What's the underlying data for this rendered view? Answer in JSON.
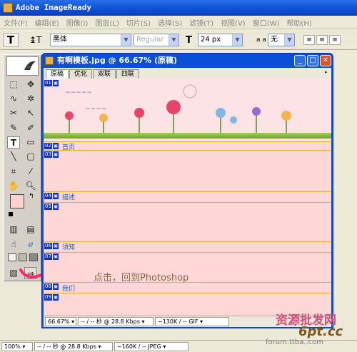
{
  "app": {
    "title": "Adobe ImageReady"
  },
  "menu": [
    "文件(F)",
    "编辑(E)",
    "图像(I)",
    "图层(L)",
    "切片(S)",
    "选择(S)",
    "滤镜(T)",
    "视图(V)",
    "窗口(W)",
    "帮助(H)"
  ],
  "options": {
    "font_family": "黑体",
    "font_style": "Regular",
    "font_size": "24 px",
    "antialias": "无",
    "aa_label": "a a"
  },
  "document": {
    "title": "有啊模板.jpg @ 66.67% (原稿)",
    "tabs": [
      {
        "label": "原稿",
        "active": true
      },
      {
        "label": "优化",
        "active": false
      },
      {
        "label": "双联",
        "active": false
      },
      {
        "label": "四联",
        "active": false
      }
    ],
    "slices": [
      {
        "num": "01",
        "icon": "▣",
        "label": ""
      },
      {
        "num": "02",
        "icon": "▣",
        "label": "首页"
      },
      {
        "num": "03",
        "icon": "▣",
        "label": ""
      },
      {
        "num": "04",
        "icon": "▣",
        "label": "描述"
      },
      {
        "num": "05",
        "icon": "▣",
        "label": ""
      },
      {
        "num": "06",
        "icon": "▣",
        "label": "须知"
      },
      {
        "num": "07",
        "icon": "▣",
        "label": ""
      },
      {
        "num": "08",
        "icon": "▣",
        "label": "我们"
      },
      {
        "num": "09",
        "icon": "▣",
        "label": ""
      }
    ],
    "status": {
      "zoom": "66.67%",
      "speed": "-- / -- 秒 @ 28.8 Kbps",
      "size": "~130K / -- GIF"
    }
  },
  "status": {
    "zoom": "100%",
    "speed": "-- / -- 秒 @ 28.8 Kbps",
    "size": "~160K / -- JPEG"
  },
  "annotation": "点击，回到Photoshop",
  "watermark": {
    "line1": "资源批发网",
    "line2": "6pt.cc",
    "line3": "forum.ttba..com"
  },
  "colors": {
    "accent": "#0a4fd6",
    "canvas": "#ffd7d7",
    "slice_badge": "#1030c8",
    "slice_line": "#e6b22e"
  },
  "toolbox_icons": [
    "marquee-icon",
    "move-icon",
    "lasso-icon",
    "magic-wand-icon",
    "slice-icon",
    "slice-select-icon",
    "brush-icon",
    "eraser-icon",
    "type-icon",
    "shape-icon",
    "line-icon",
    "crop-icon",
    "eyedropper-icon",
    "hand-icon",
    "zoom-icon",
    "swap-colors-icon",
    "imagemap-icon",
    "preview-icon",
    "jump-to-photoshop-icon"
  ]
}
